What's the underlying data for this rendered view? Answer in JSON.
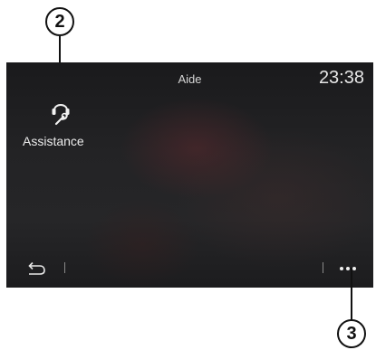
{
  "header": {
    "title": "Aide",
    "time": "23:38"
  },
  "tiles": [
    {
      "label": "Assistance",
      "icon": "headset-wrench-icon"
    }
  ],
  "bottom_bar": {
    "back_icon": "back-arrow-icon",
    "more_icon": "more-dots-icon"
  },
  "callouts": {
    "c2": "2",
    "c3": "3"
  },
  "colors": {
    "screen_bg": "#1f1f21",
    "text": "#e6e6e6",
    "callout": "#111111"
  }
}
